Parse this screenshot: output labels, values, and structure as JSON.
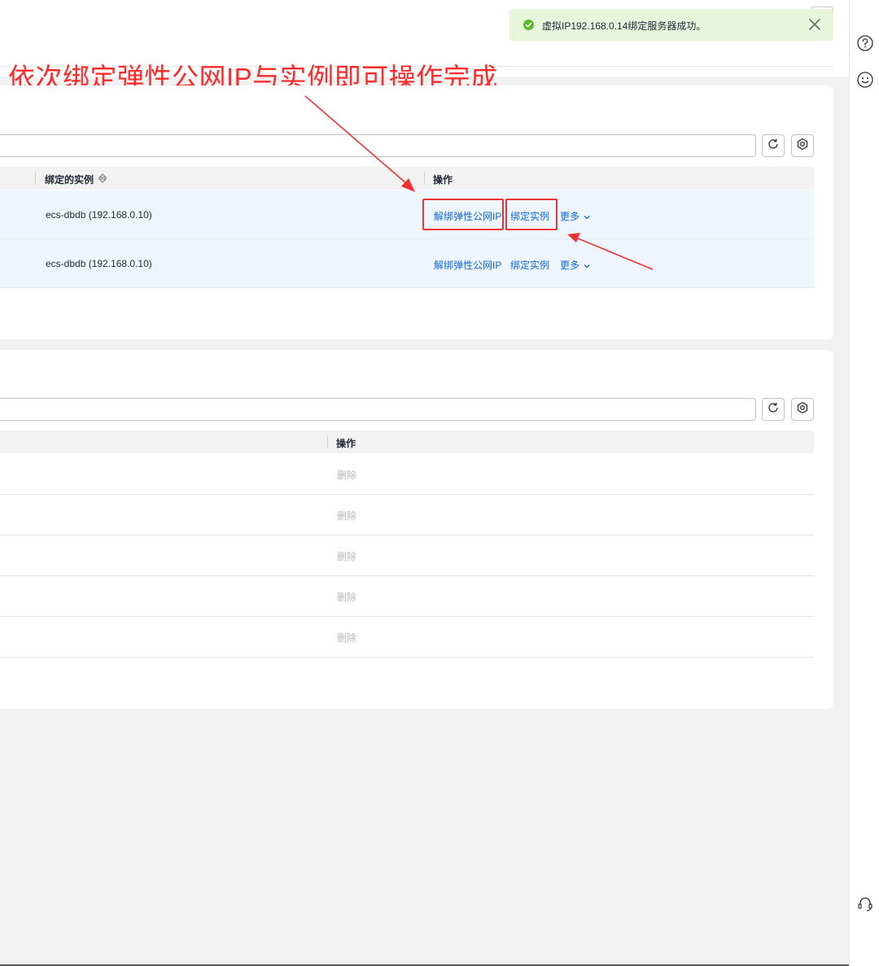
{
  "toast": {
    "message": "虚拟IP192.168.0.14绑定服务器成功。",
    "status": "success",
    "success_color": "#5cb82b"
  },
  "annotation": {
    "text": "依次绑定弹性公网IP与实例即可操作完成",
    "color": "#ff2a2a"
  },
  "table1": {
    "columns": [
      "绑定的实例",
      "操作"
    ],
    "rows": [
      {
        "instance": "ecs-dbdb   (192.168.0.10)",
        "actions": [
          "解绑弹性公网IP",
          "绑定实例",
          "更多"
        ]
      },
      {
        "instance": "ecs-dbdb   (192.168.0.10)",
        "actions": [
          "解绑弹性公网IP",
          "绑定实例",
          "更多"
        ]
      }
    ]
  },
  "table2": {
    "columns": [
      "操作"
    ],
    "rows": [
      {
        "action": "删除"
      },
      {
        "action": "删除"
      },
      {
        "action": "删除"
      },
      {
        "action": "删除"
      },
      {
        "action": "删除"
      }
    ]
  },
  "icons": {
    "help": "help-circle-icon",
    "feedback": "smile-icon",
    "service": "headset-icon",
    "refresh": "refresh-icon",
    "settings": "gear-icon",
    "sort": "sort-icon",
    "dropdown": "chevron-down-icon",
    "close": "close-icon"
  },
  "colors": {
    "link": "#0d6ad8",
    "highlight": "#f03232",
    "row_selected": "#eff5fd"
  }
}
